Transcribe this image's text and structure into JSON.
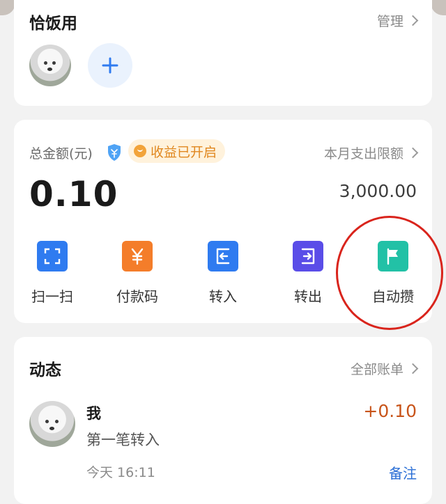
{
  "members": {
    "title": "恰饭用",
    "manage_label": "管理",
    "add_icon": "plus-icon"
  },
  "balance": {
    "total_label": "总金额(元)",
    "income_badge": "收益已开启",
    "amount": "0.10",
    "limit_label": "本月支出限额",
    "limit_value": "3,000.00",
    "actions": [
      {
        "label": "扫一扫",
        "icon": "scan-icon",
        "color": "#2f7bf0"
      },
      {
        "label": "付款码",
        "icon": "yuan-icon",
        "color": "#f47d2a"
      },
      {
        "label": "转入",
        "icon": "transfer-in-icon",
        "color": "#2f7bf0"
      },
      {
        "label": "转出",
        "icon": "transfer-out-icon",
        "color": "#5a4de8"
      },
      {
        "label": "自动攒",
        "icon": "flag-icon",
        "color": "#22c1a6"
      }
    ]
  },
  "activity": {
    "title": "动态",
    "all_bills_label": "全部账单",
    "transaction": {
      "name": "我",
      "description": "第一笔转入",
      "amount": "+0.10",
      "time": "今天 16:11",
      "note_label": "备注"
    }
  },
  "colors": {
    "accent_blue": "#2f7bf0",
    "positive_amount": "#c8541a",
    "badge_orange": "#e0871f",
    "highlight_circle": "#d9241c"
  }
}
